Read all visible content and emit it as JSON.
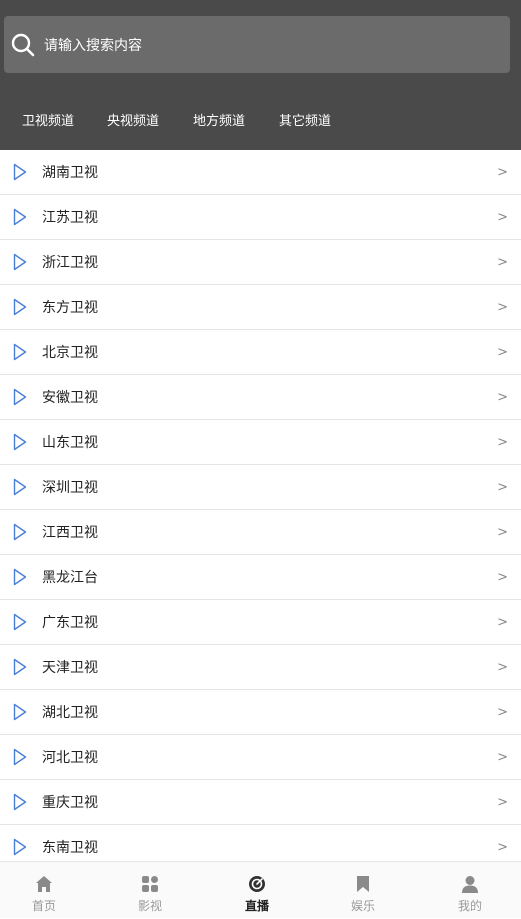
{
  "search": {
    "placeholder": "请输入搜索内容"
  },
  "tabs": [
    {
      "label": "卫视频道"
    },
    {
      "label": "央视频道"
    },
    {
      "label": "地方频道"
    },
    {
      "label": "其它频道"
    }
  ],
  "channels": [
    {
      "label": "湖南卫视"
    },
    {
      "label": "江苏卫视"
    },
    {
      "label": "浙江卫视"
    },
    {
      "label": "东方卫视"
    },
    {
      "label": "北京卫视"
    },
    {
      "label": "安徽卫视"
    },
    {
      "label": "山东卫视"
    },
    {
      "label": "深圳卫视"
    },
    {
      "label": "江西卫视"
    },
    {
      "label": "黑龙江台"
    },
    {
      "label": "广东卫视"
    },
    {
      "label": "天津卫视"
    },
    {
      "label": "湖北卫视"
    },
    {
      "label": "河北卫视"
    },
    {
      "label": "重庆卫视"
    },
    {
      "label": "东南卫视"
    }
  ],
  "chevron": ">",
  "tabbar": [
    {
      "label": "首页",
      "icon": "home-icon"
    },
    {
      "label": "影视",
      "icon": "grid-icon"
    },
    {
      "label": "直播",
      "icon": "live-icon",
      "active": true
    },
    {
      "label": "娱乐",
      "icon": "bookmark-icon"
    },
    {
      "label": "我的",
      "icon": "user-icon"
    }
  ],
  "colors": {
    "header_bg": "#4a4a4a",
    "search_bg": "#6b6b6b",
    "play_icon": "#4a7fd6",
    "tabbar_active": "#222222",
    "tabbar_inactive": "#999999"
  }
}
